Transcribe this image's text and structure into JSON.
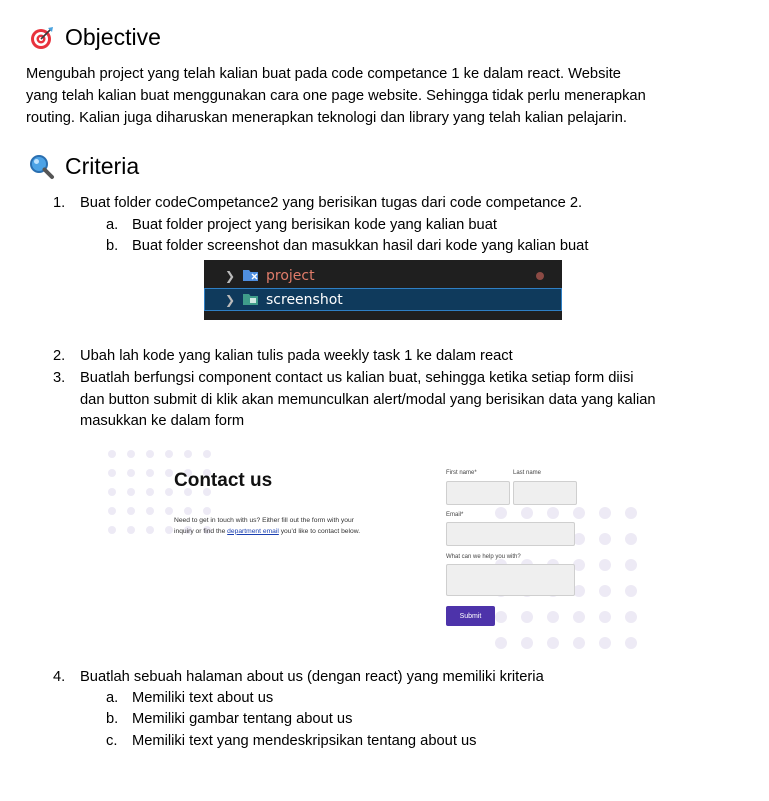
{
  "objective": {
    "title": "Objective",
    "icon": "target-icon",
    "paragraph_lines": [
      "Mengubah project yang telah kalian buat pada code competance 1 ke dalam react. Website",
      "yang telah kalian buat menggunakan cara one page website. Sehingga tidak perlu menerapkan",
      "routing. Kalian juga diharuskan menerapkan teknologi dan library yang telah kalian pelajarin."
    ]
  },
  "criteria": {
    "title": "Criteria",
    "icon": "magnifier-icon",
    "items": [
      {
        "num": "1.",
        "lines": [
          "Buat folder codeCompetance2 yang berisikan tugas dari code competance 2."
        ],
        "subitems": [
          {
            "num": "a.",
            "text": "Buat folder project yang berisikan kode yang kalian buat"
          },
          {
            "num": "b.",
            "text": "Buat folder screenshot dan masukkan hasil dari kode yang kalian buat"
          }
        ]
      },
      {
        "num": "2.",
        "lines": [
          "Ubah lah kode yang kalian tulis pada weekly task 1 ke dalam react"
        ]
      },
      {
        "num": "3.",
        "lines": [
          "Buatlah berfungsi component contact us kalian buat, sehingga ketika setiap form diisi",
          "dan button submit di klik akan memunculkan alert/modal yang berisikan data yang kalian",
          "masukkan ke dalam form"
        ]
      },
      {
        "num": "4.",
        "lines": [
          "Buatlah sebuah halaman about us (dengan react) yang memiliki kriteria"
        ],
        "subitems": [
          {
            "num": "a.",
            "text": "Memiliki text about us"
          },
          {
            "num": "b.",
            "text": "Memiliki gambar tentang about us"
          },
          {
            "num": "c.",
            "text": "Memiliki text yang mendeskripsikan tentang about us"
          }
        ]
      }
    ]
  },
  "folder_screenshot": {
    "folders": [
      {
        "name": "project",
        "icon": "project-folder-icon",
        "color": "#e07c6a"
      },
      {
        "name": "screenshot",
        "icon": "screenshot-folder-icon",
        "color": "#ffffff"
      }
    ]
  },
  "contact_screenshot": {
    "title": "Contact us",
    "desc_before": "Need to get in touch with us? Either fill out the form with your inquiry or find the ",
    "desc_link": "department email",
    "desc_after": " you'd like to contact below.",
    "first_name_label": "First name*",
    "last_name_label": "Last name",
    "email_label": "Email*",
    "message_label": "What can we help you with?",
    "submit_label": "Submit",
    "accent_color": "#4d33aa"
  }
}
